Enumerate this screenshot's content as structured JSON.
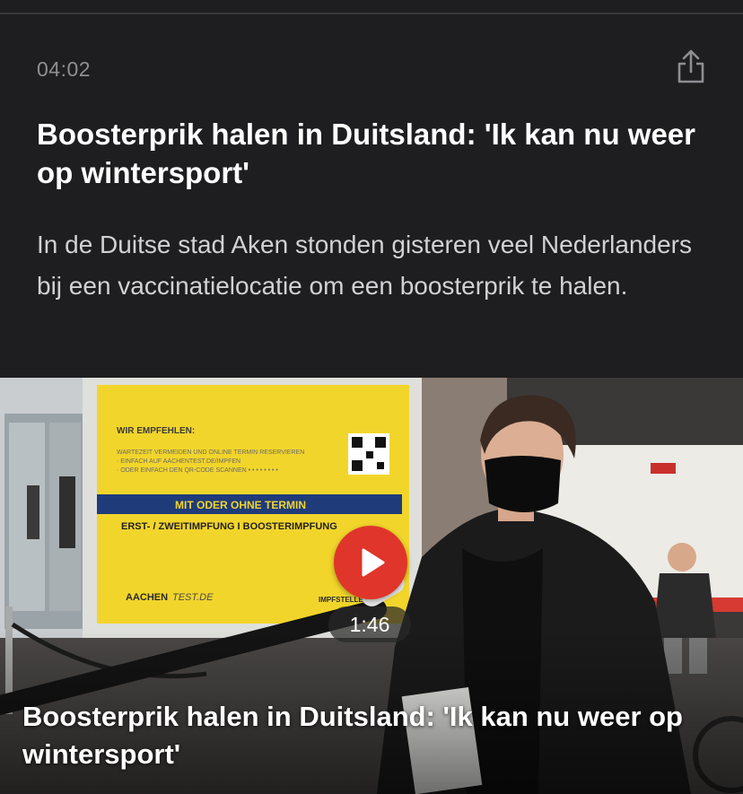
{
  "article": {
    "timestamp": "04:02",
    "headline": "Boosterprik halen in Duitsland: 'Ik kan nu weer op wintersport'",
    "summary": "In de Duitse stad Aken stonden gisteren veel Nederlanders bij een vaccinatielocatie om een boosterprik te halen."
  },
  "share": {
    "icon": "share-icon"
  },
  "video": {
    "duration": "1:46",
    "title": "Boosterprik halen in Duitsland: 'Ik kan nu weer op wintersport'",
    "play_icon": "play-icon",
    "accent_color": "#e0352a",
    "poster": {
      "heading": "WIR EMPFEHLEN:",
      "line1": "WARTEZEIT VERMEIDEN UND ONLINE TERMIN RESERVIEREN",
      "line2": "· EINFACH AUF AACHENTEST.DE/IMPFEN",
      "line3": "· ODER EINFACH DEN QR-CODE SCANNEN • • • • • • • •",
      "band": "MIT ODER OHNE TERMIN",
      "vaccines": "ERST- / ZWEITIMPFUNG I BOOSTERIMPFUNG",
      "brand_bold": "AACHEN",
      "brand_light": "TEST.DE",
      "location": "IMPFSTELLE"
    }
  }
}
